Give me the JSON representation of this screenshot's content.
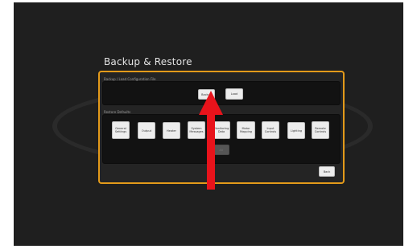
{
  "page_title": "Backup & Restore",
  "sections": {
    "backup": {
      "label": "Backup / Load Configuration File",
      "backup_label": "Backup",
      "load_label": "Load"
    },
    "defaults": {
      "label": "Restore Defaults",
      "buttons": [
        "General Settings",
        "Output",
        "Heater",
        "System Messages",
        "Monitoring Data",
        "Motor Mapping",
        "Input Controls",
        "Lighting",
        "Remote Controls"
      ],
      "all_label": "All"
    }
  },
  "footer": {
    "back_label": "Back"
  },
  "colors": {
    "accent": "#e39a1a",
    "annotation_arrow": "#e8131b"
  }
}
